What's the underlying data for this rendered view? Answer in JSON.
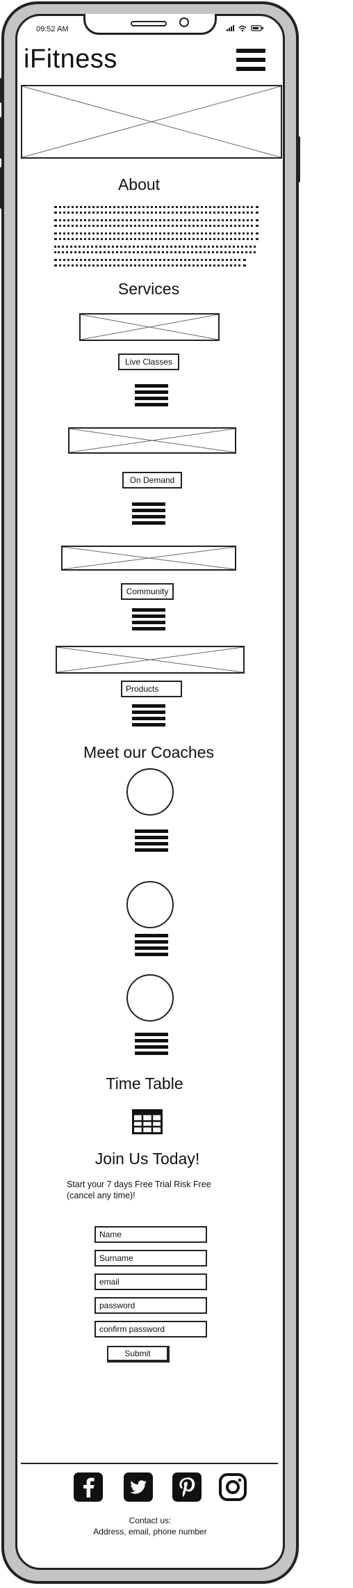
{
  "status_bar": {
    "time": "09:52 AM",
    "icons": "signal wifi battery"
  },
  "header": {
    "brand": "iFitness",
    "menu_icon": "hamburger-menu-icon"
  },
  "about": {
    "title": "About"
  },
  "services": {
    "title": "Services",
    "items": [
      {
        "label": "Live Classes"
      },
      {
        "label": "On Demand"
      },
      {
        "label": "Community"
      },
      {
        "label": "Products"
      }
    ]
  },
  "coaches": {
    "title": "Meet our Coaches"
  },
  "timetable": {
    "title": "Time Table",
    "icon": "calendar-grid-icon"
  },
  "join": {
    "title": "Join Us Today!",
    "subtitle_line1": "Start your 7 days Free Trial Risk Free",
    "subtitle_line2": "(cancel any time)!",
    "fields": {
      "name": "Name",
      "surname": "Surname",
      "email": "email",
      "password": "password",
      "confirm": "confirm password"
    },
    "submit_label": "Submit"
  },
  "footer": {
    "social_icons": [
      "facebook-icon",
      "twitter-icon",
      "pinterest-icon",
      "instagram-icon"
    ],
    "contact_title": "Contact us:",
    "contact_details": "Address, email, phone number"
  }
}
